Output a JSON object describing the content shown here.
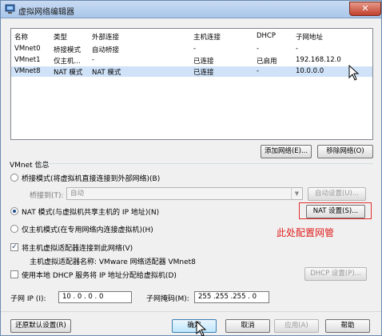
{
  "window": {
    "title": "虚拟网络编辑器",
    "close_glyph": "✕"
  },
  "table": {
    "headers": [
      "名称",
      "类型",
      "外部连接",
      "主机连接",
      "DHCP",
      "子网地址"
    ],
    "rows": [
      {
        "name": "VMnet0",
        "type": "桥接模式",
        "external": "自动桥接",
        "host": "-",
        "dhcp": "-",
        "subnet": "-"
      },
      {
        "name": "VMnet1",
        "type": "仅主机...",
        "external": "-",
        "host": "已连接",
        "dhcp": "已启用",
        "subnet": "192.168.12.0"
      },
      {
        "name": "VMnet8",
        "type": "NAT 模式",
        "external": "NAT 模式",
        "host": "已连接",
        "dhcp": "-",
        "subnet": "10.0.0.0"
      }
    ],
    "selected_row": 2
  },
  "buttons": {
    "add_network": "添加网络(E)...",
    "remove_network": "移除网络(O)",
    "auto_settings": "自动设置(U)...",
    "nat_settings": "NAT 设置(S)...",
    "dhcp_settings": "DHCP 设置(P)...",
    "restore_defaults": "还原默认设置(R)",
    "ok": "确定",
    "cancel": "取消",
    "apply": "应用(A)",
    "help": "帮助"
  },
  "vmnet_info": {
    "title": "VMnet 信息",
    "bridged_mode": "桥接模式(将虚拟机直接连接到外部网络)(B)",
    "bridged_to_label": "桥接到(T):",
    "bridged_to_value": "自动",
    "nat_mode": "NAT 模式(与虚拟机共享主机的 IP 地址)(N)",
    "host_only_mode": "仅主机模式(在专用网络内连接虚拟机)(H)",
    "selected_mode": "nat",
    "connect_adapter": "将主机虚拟适配器连接到此网络(V)",
    "connect_adapter_checked": true,
    "adapter_name": "主机虚拟适配器名称: VMware 网络适配器 VMnet8",
    "use_dhcp": "使用本地 DHCP 服务将 IP 地址分配给虚拟机(D)",
    "use_dhcp_checked": false,
    "subnet_ip_label": "子网 IP (I):",
    "subnet_ip_value": "10 . 0 . 0 . 0",
    "subnet_mask_label": "子网掩码(M):",
    "subnet_mask_value": "255 .255 .255 . 0"
  },
  "annotation": {
    "text": "此处配置网管",
    "color": "#e02020"
  },
  "colors": {
    "titlebar": "#b7d0ee",
    "selection": "#cfe2f8",
    "close": "#c0412c"
  }
}
